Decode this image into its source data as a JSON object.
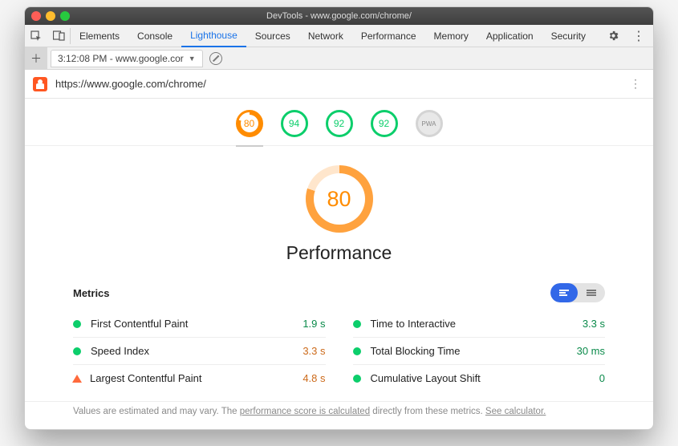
{
  "window": {
    "title": "DevTools - www.google.com/chrome/"
  },
  "tabs": [
    "Elements",
    "Console",
    "Lighthouse",
    "Sources",
    "Network",
    "Performance",
    "Memory",
    "Application",
    "Security"
  ],
  "activeTab": "Lighthouse",
  "throttle": {
    "timestamp": "3:12:08 PM",
    "host": "www.google.cor"
  },
  "url": "https://www.google.com/chrome/",
  "gauges": [
    {
      "score": "80",
      "status": "orange"
    },
    {
      "score": "94",
      "status": "green"
    },
    {
      "score": "92",
      "status": "green"
    },
    {
      "score": "92",
      "status": "green"
    },
    {
      "score": "PWA",
      "status": "pwa"
    }
  ],
  "big": {
    "score": "80",
    "label": "Performance"
  },
  "metricsHeader": "Metrics",
  "metrics": [
    {
      "name": "First Contentful Paint",
      "value": "1.9 s",
      "status": "green",
      "valueClass": "v-green"
    },
    {
      "name": "Time to Interactive",
      "value": "3.3 s",
      "status": "green",
      "valueClass": "v-green"
    },
    {
      "name": "Speed Index",
      "value": "3.3 s",
      "status": "green",
      "valueClass": "v-orange"
    },
    {
      "name": "Total Blocking Time",
      "value": "30 ms",
      "status": "green",
      "valueClass": "v-green"
    },
    {
      "name": "Largest Contentful Paint",
      "value": "4.8 s",
      "status": "orange",
      "valueClass": "v-orange"
    },
    {
      "name": "Cumulative Layout Shift",
      "value": "0",
      "status": "green",
      "valueClass": "v-green"
    }
  ],
  "footer": {
    "pre": "Values are estimated and may vary. The ",
    "link1": "performance score is calculated",
    "mid": " directly from these metrics. ",
    "link2": "See calculator."
  }
}
